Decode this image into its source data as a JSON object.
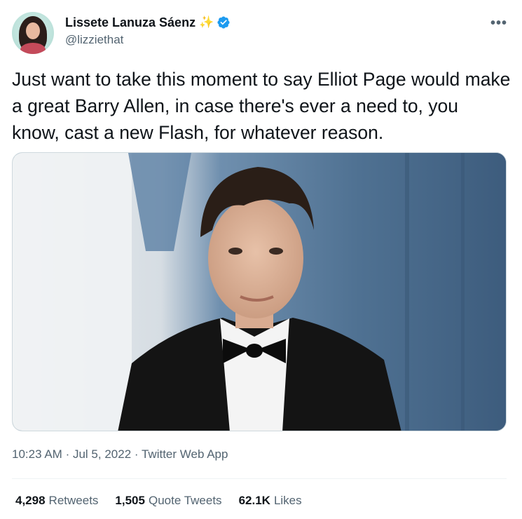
{
  "author": {
    "display_name": "Lissete Lanuza Sáenz",
    "emoji": "✨",
    "handle": "@lizziethat",
    "verified_color": "#1d9bf0"
  },
  "tweet": {
    "text": "Just want to take this moment to say Elliot Page would make a great Barry Allen, in case there's ever a need to, you know, cast a new Flash, for whatever reason.",
    "time": "10:23 AM",
    "date": "Jul 5, 2022",
    "source": "Twitter Web App",
    "separator": "·"
  },
  "media": {
    "description_icon": "photo-person-in-tuxedo"
  },
  "stats": [
    {
      "count": "4,298",
      "label": "Retweets"
    },
    {
      "count": "1,505",
      "label": "Quote Tweets"
    },
    {
      "count": "62.1K",
      "label": "Likes"
    }
  ],
  "more_menu": "•••"
}
